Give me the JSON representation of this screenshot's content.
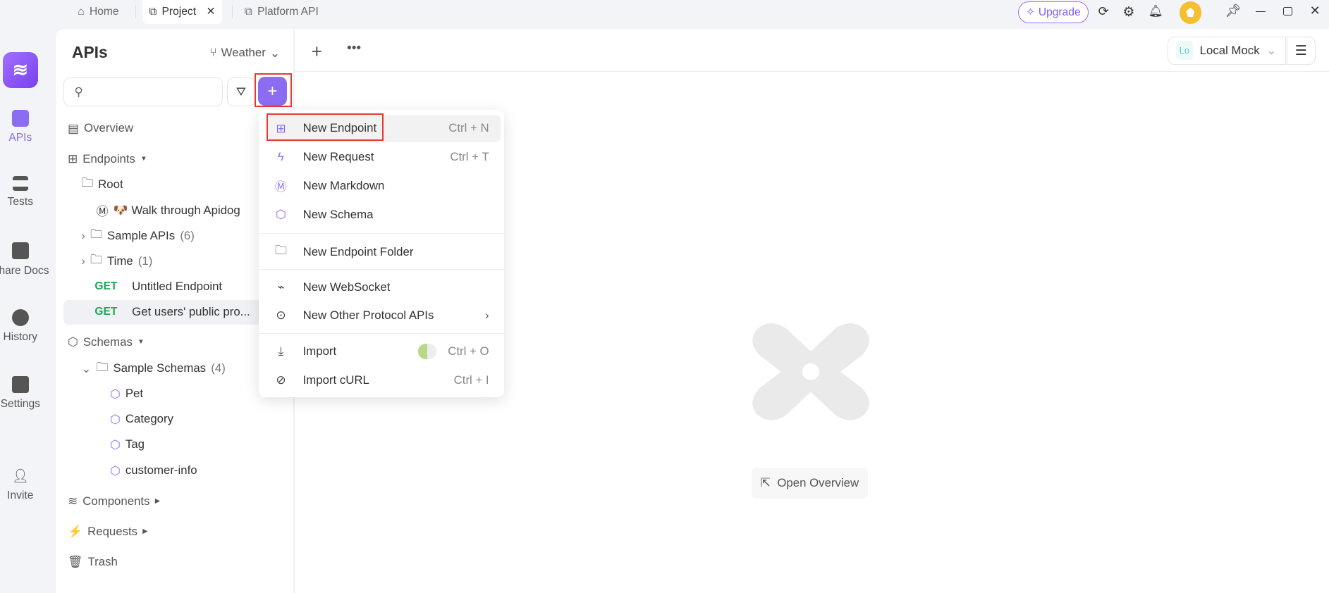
{
  "tabs": [
    {
      "label": "Home",
      "icon": "home-icon"
    },
    {
      "label": "Project",
      "icon": "external-link-icon",
      "active": true
    },
    {
      "label": "Platform API",
      "icon": "external-link-icon"
    }
  ],
  "titlebar": {
    "upgrade": "Upgrade"
  },
  "rail": {
    "items": [
      {
        "label": "APIs",
        "active": true
      },
      {
        "label": "Tests"
      },
      {
        "label": "Share Docs"
      },
      {
        "label": "History"
      },
      {
        "label": "Settings"
      },
      {
        "label": "Invite"
      }
    ]
  },
  "panel": {
    "title": "APIs",
    "branch": "Weather",
    "search_placeholder": "",
    "tree": {
      "overview": "Overview",
      "endpoints": "Endpoints",
      "root": "Root",
      "walk": "🐶 Walk through Apidog",
      "sample_apis": "Sample APIs",
      "sample_apis_count": "(6)",
      "time": "Time",
      "time_count": "(1)",
      "ep1_method": "GET",
      "ep1": "Untitled Endpoint",
      "ep2_method": "GET",
      "ep2": "Get users' public pro...",
      "schemas": "Schemas",
      "sample_schemas": "Sample Schemas",
      "sample_schemas_count": "(4)",
      "schema_items": [
        "Pet",
        "Category",
        "Tag",
        "customer-info"
      ],
      "components": "Components",
      "requests": "Requests",
      "trash": "Trash"
    }
  },
  "menu": {
    "items": [
      {
        "label": "New Endpoint",
        "shortcut": "Ctrl + N"
      },
      {
        "label": "New Request",
        "shortcut": "Ctrl + T"
      },
      {
        "label": "New Markdown"
      },
      {
        "label": "New Schema"
      },
      {
        "label": "New Endpoint Folder"
      },
      {
        "label": "New WebSocket"
      },
      {
        "label": "New Other Protocol APIs"
      },
      {
        "label": "Import",
        "shortcut": "Ctrl + O"
      },
      {
        "label": "Import cURL",
        "shortcut": "Ctrl + I"
      }
    ]
  },
  "main": {
    "env_badge": "Lo",
    "env": "Local Mock",
    "open_overview": "Open Overview"
  },
  "colors": {
    "accent": "#8c6cf0",
    "get": "#1aaa55",
    "highlight": "#e53935"
  }
}
